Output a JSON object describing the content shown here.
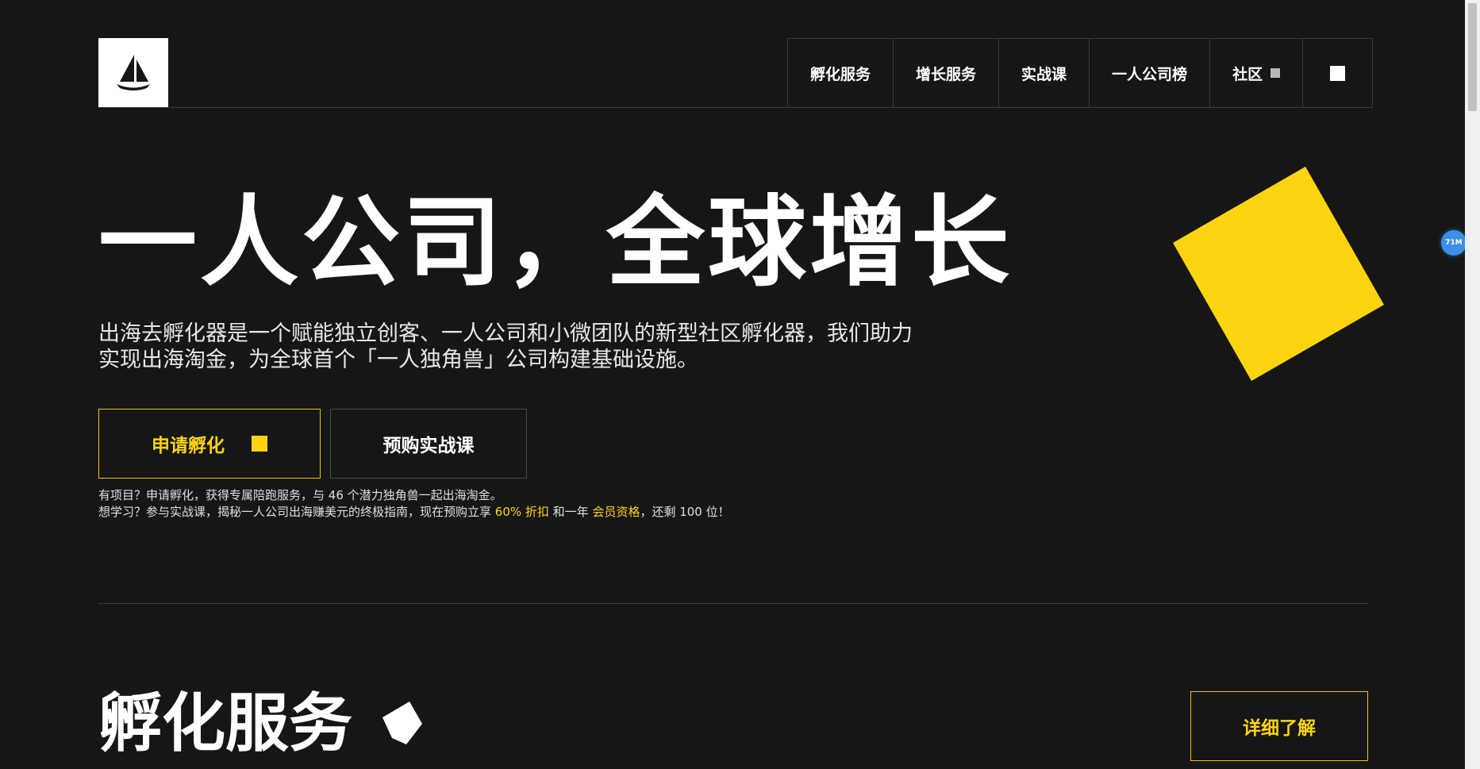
{
  "header": {
    "logo_icon": "sailboat-icon",
    "nav": [
      {
        "label": "孵化服务"
      },
      {
        "label": "增长服务"
      },
      {
        "label": "实战课"
      },
      {
        "label": "一人公司榜"
      },
      {
        "label": "社区"
      }
    ],
    "menu_icon": "square-icon"
  },
  "hero": {
    "title": "一人公司，全球增长",
    "description": "出海去孵化器是一个赋能独立创客、一人公司和小微团队的新型社区孵化器，我们助力实现出海淘金，为全球首个「一人独角兽」公司构建基础设施。",
    "primary_button": "申请孵化",
    "secondary_button": "预购实战课",
    "note1": "有项目？申请孵化，获得专属陪跑服务，与 46 个潜力独角兽一起出海淘金。",
    "note2_prefix": "想学习？参与实战课，揭秘一人公司出海赚美元的终极指南，现在预购立享 ",
    "note2_highlight1": "60% 折扣",
    "note2_mid": " 和一年 ",
    "note2_highlight2": "会员资格",
    "note2_suffix": "，还剩 100 位！"
  },
  "section": {
    "title": "孵化服务",
    "detail_button": "详细了解"
  },
  "badge": {
    "label": "71M"
  },
  "colors": {
    "background": "#161616",
    "accent": "#fdd40f",
    "border": "#3a3a3a"
  }
}
